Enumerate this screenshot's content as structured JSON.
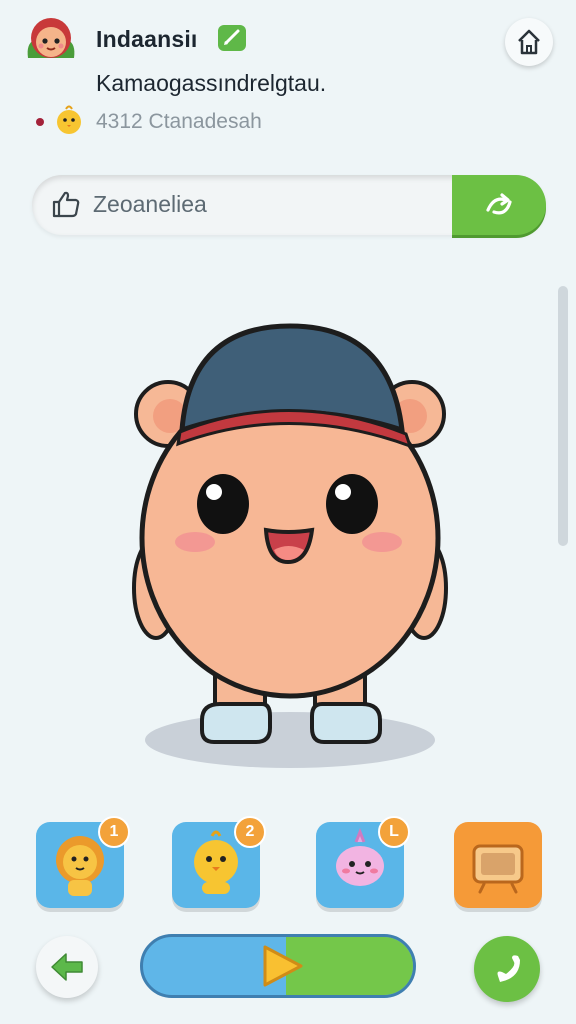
{
  "header": {
    "title": "Indaansiı",
    "subtitle": "Kamaogassındrelgtau.",
    "stat": "4312 Ctanadesah"
  },
  "search": {
    "value": "Zeoaneliea"
  },
  "pets": [
    {
      "name": "lion-pet",
      "badge": "1",
      "bg": "#5ab6e8"
    },
    {
      "name": "chick-pet",
      "badge": "2",
      "bg": "#5ab6e8"
    },
    {
      "name": "pink-pet",
      "badge": "L",
      "bg": "#5ab6e8"
    },
    {
      "name": "tv-item",
      "badge": "",
      "bg": "#f59a38"
    }
  ],
  "progress": {
    "fraction": 0.47
  },
  "colors": {
    "accent_green": "#6cc044",
    "accent_blue": "#5ab6e8",
    "badge_orange": "#f3a23a"
  }
}
